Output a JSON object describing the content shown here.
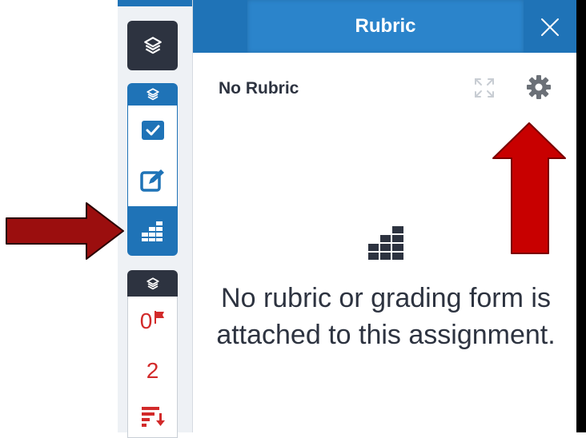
{
  "header": {
    "title": "Rubric"
  },
  "panel": {
    "label": "No Rubric",
    "empty_message": "No rubric or grading form is attached to this assignment."
  },
  "rail": {
    "counters": {
      "flag_count": "0",
      "count": "2"
    }
  },
  "colors": {
    "brand_blue": "#1f73b7",
    "dark": "#2d3340",
    "alert_red": "#d22a2a",
    "arrow_red": "#b40000"
  },
  "icons": [
    "layers-icon",
    "check-icon",
    "edit-icon",
    "rubric-grid-icon",
    "flag-icon",
    "sort-icon",
    "close-icon",
    "expand-icon",
    "gear-icon"
  ]
}
